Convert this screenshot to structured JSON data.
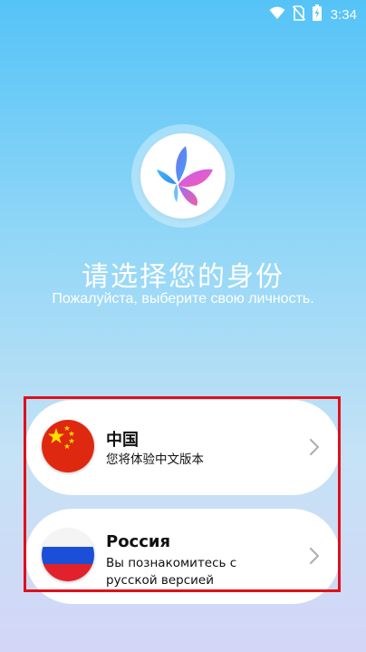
{
  "status_bar": {
    "time": "3:34",
    "icons": [
      "wifi-icon",
      "no-sim-icon",
      "battery-charging-icon"
    ]
  },
  "logo": {
    "icon": "butterfly-logo-icon"
  },
  "header": {
    "title": "请选择您的身份",
    "subtitle": "Пожалуйста, выберите свою личность."
  },
  "options": [
    {
      "name": "中国",
      "description": "您将体验中文版本",
      "flag": "china-flag-icon"
    },
    {
      "name": "Россия",
      "description": "Вы познакомитесь с русской версией",
      "flag": "russia-flag-icon"
    }
  ],
  "colors": {
    "highlight_border": "#e0101a",
    "background_top": "#55c3f7",
    "background_bottom": "#d4d6f7"
  }
}
